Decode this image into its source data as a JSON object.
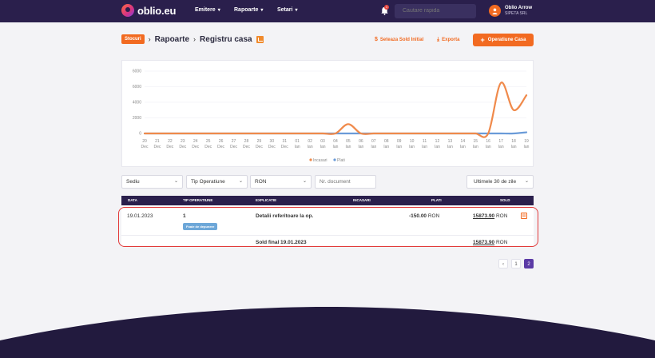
{
  "header": {
    "logo_text": "oblio.eu",
    "nav": [
      {
        "label": "Emitere"
      },
      {
        "label": "Rapoarte"
      },
      {
        "label": "Setari"
      }
    ],
    "notifications_count": "1",
    "search_placeholder": "Cautare rapida",
    "user_name": "Oblio Arrow",
    "user_company": "SIPETA SRL"
  },
  "breadcrumb": {
    "badge": "Stocuri",
    "items": [
      "Rapoarte",
      "Registru casa"
    ]
  },
  "actions": {
    "set_balance": "Seteaza Sold Initial",
    "export": "Exporta",
    "add_operation": "Operatiune Casa"
  },
  "chart_data": {
    "type": "line",
    "categories": [
      "20 Dec",
      "21 Dec",
      "22 Dec",
      "23 Dec",
      "24 Dec",
      "25 Dec",
      "26 Dec",
      "27 Dec",
      "28 Dec",
      "29 Dec",
      "30 Dec",
      "31 Dec",
      "01 Ian",
      "02 Ian",
      "03 Ian",
      "04 Ian",
      "05 Ian",
      "06 Ian",
      "07 Ian",
      "08 Ian",
      "09 Ian",
      "10 Ian",
      "11 Ian",
      "12 Ian",
      "13 Ian",
      "14 Ian",
      "15 Ian",
      "16 Ian",
      "17 Ian",
      "18 Ian",
      "19 Ian"
    ],
    "x_day_labels": [
      "20",
      "21",
      "22",
      "23",
      "24",
      "25",
      "26",
      "27",
      "28",
      "29",
      "30",
      "31",
      "01",
      "02",
      "03",
      "04",
      "05",
      "06",
      "07",
      "08",
      "09",
      "10",
      "11",
      "12",
      "13",
      "14",
      "15",
      "16",
      "17",
      "18",
      "19"
    ],
    "x_month_labels": [
      "Dec",
      "Dec",
      "Dec",
      "Dec",
      "Dec",
      "Dec",
      "Dec",
      "Dec",
      "Dec",
      "Dec",
      "Dec",
      "Dec",
      "Ian",
      "Ian",
      "Ian",
      "Ian",
      "Ian",
      "Ian",
      "Ian",
      "Ian",
      "Ian",
      "Ian",
      "Ian",
      "Ian",
      "Ian",
      "Ian",
      "Ian",
      "Ian",
      "Ian",
      "Ian",
      "Ian"
    ],
    "series": [
      {
        "name": "Incasari",
        "color": "#f08a4b",
        "values": [
          0,
          0,
          0,
          0,
          0,
          0,
          0,
          0,
          0,
          0,
          0,
          0,
          0,
          0,
          0,
          0,
          1200,
          0,
          0,
          0,
          0,
          0,
          0,
          0,
          0,
          0,
          0,
          0,
          6500,
          3000,
          4900
        ]
      },
      {
        "name": "Plati",
        "color": "#6a9bd8",
        "values": [
          0,
          0,
          0,
          0,
          0,
          0,
          0,
          0,
          0,
          0,
          0,
          0,
          0,
          0,
          0,
          0,
          0,
          0,
          0,
          0,
          0,
          0,
          0,
          0,
          0,
          0,
          0,
          0,
          0,
          0,
          150
        ]
      }
    ],
    "y_ticks": [
      "6000",
      "6000",
      "4000",
      "2000",
      "0"
    ],
    "y_tick_values": [
      8000,
      6000,
      4000,
      2000,
      0
    ],
    "ylim": [
      0,
      8000
    ],
    "grid": true,
    "legend": "bottom-center"
  },
  "filters": {
    "sediu": "Sediu",
    "tip_operatiune": "Tip Operatiune",
    "moneda": "RON",
    "nr_document_placeholder": "Nr. document",
    "period": "Ultimele 30 de zile"
  },
  "table": {
    "headers": [
      "Data",
      "Tip operatiune",
      "Explicatie",
      "Incasari",
      "Plati",
      "Sold"
    ],
    "row": {
      "date": "19.01.2023",
      "tip": "1",
      "tag": "Foaie de depunere",
      "explicatie": "Detalii referitoare la op.",
      "plati": "-150.00",
      "plati_currency": "RON",
      "sold": "15873.90",
      "sold_currency": "RON"
    },
    "final": {
      "label": "Sold final 19.01.2023",
      "sold": "15873.90",
      "currency": "RON"
    }
  },
  "pagination": {
    "pages": [
      "1",
      "2"
    ],
    "prev": "‹",
    "active": "2"
  }
}
